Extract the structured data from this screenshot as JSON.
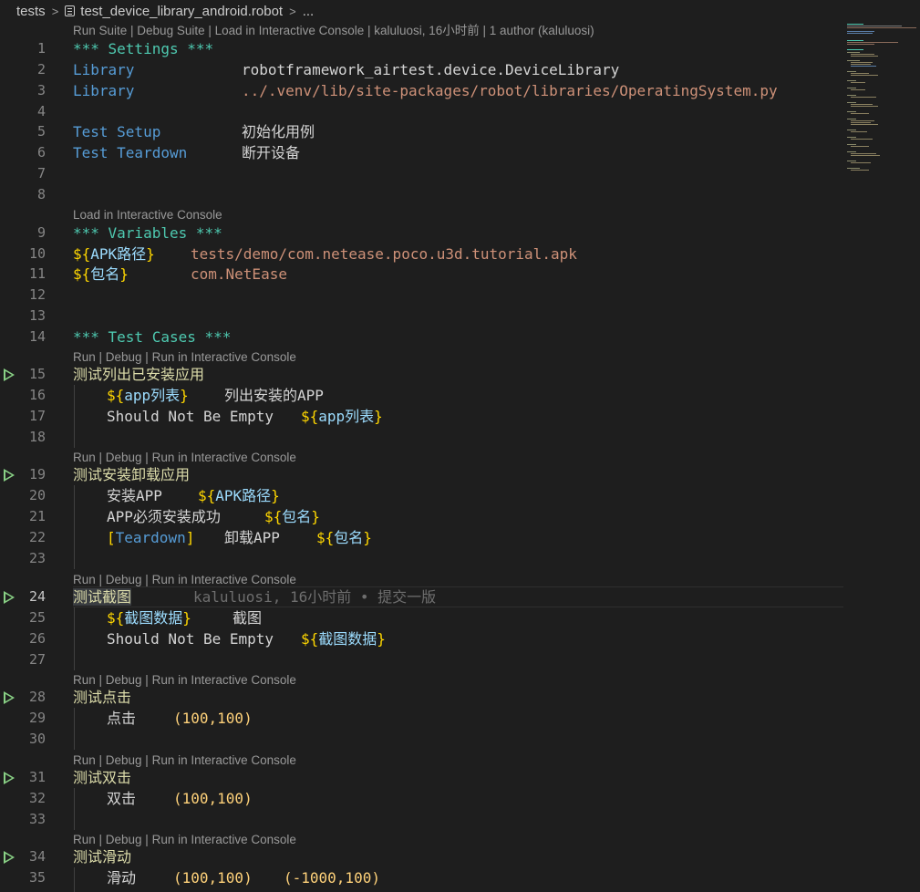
{
  "breadcrumb": {
    "folder": "tests",
    "file": "test_device_library_android.robot",
    "more": "..."
  },
  "codelens": {
    "top": "Run Suite | Debug Suite | Load in Interactive Console | kaluluosi, 16小时前 | 1 author (kaluluosi)",
    "variables": "Load in Interactive Console",
    "case": "Run | Debug | Run in Interactive Console"
  },
  "lines": {
    "l1": "*** Settings ***",
    "l2_key": "Library",
    "l2_val": "robotframework_airtest.device.DeviceLibrary",
    "l3_key": "Library",
    "l3_val": "../.venv/lib/site-packages/robot/libraries/OperatingSystem.py",
    "l5_key": "Test Setup",
    "l5_val": "初始化用例",
    "l6_key": "Test Teardown",
    "l6_val": "断开设备",
    "l9": "*** Variables ***",
    "l10_open": "${",
    "l10_name": "APK路径",
    "l10_close": "}",
    "l10_val": "tests/demo/com.netease.poco.u3d.tutorial.apk",
    "l11_open": "${",
    "l11_name": "包名",
    "l11_close": "}",
    "l11_val": "com.NetEase",
    "l14": "*** Test Cases ***",
    "l15": "测试列出已安装应用",
    "l16_open": "${",
    "l16_name": "app列表",
    "l16_close": "}",
    "l16_kw": "列出安装的APP",
    "l17_kw": "Should Not Be Empty",
    "l17_open": "${",
    "l17_name": "app列表",
    "l17_close": "}",
    "l19": "测试安装卸载应用",
    "l20_kw": "安装APP",
    "l20_open": "${",
    "l20_name": "APK路径",
    "l20_close": "}",
    "l21_kw": "APP必须安装成功",
    "l21_open": "${",
    "l21_name": "包名",
    "l21_close": "}",
    "l22_br_open": "[",
    "l22_setting": "Teardown",
    "l22_br_close": "]",
    "l22_kw": "卸载APP",
    "l22_open": "${",
    "l22_name": "包名",
    "l22_close": "}",
    "l24": "测试截图",
    "l24_blame": "kaluluosi, 16小时前 • 提交一版",
    "l25_open": "${",
    "l25_name": "截图数据",
    "l25_close": "}",
    "l25_kw": "截图",
    "l26_kw": "Should Not Be Empty",
    "l26_open": "${",
    "l26_name": "截图数据",
    "l26_close": "}",
    "l28": "测试点击",
    "l29_kw": "点击",
    "l29_arg": "(100,100)",
    "l31": "测试双击",
    "l32_kw": "双击",
    "l32_arg": "(100,100)",
    "l34": "测试滑动",
    "l35_kw": "滑动",
    "l35_arg1": "(100,100)",
    "l35_arg2": "(-1000,100)"
  },
  "line_numbers": [
    "1",
    "2",
    "3",
    "4",
    "5",
    "6",
    "7",
    "8",
    "9",
    "10",
    "11",
    "12",
    "13",
    "14",
    "15",
    "16",
    "17",
    "18",
    "19",
    "20",
    "21",
    "22",
    "23",
    "24",
    "25",
    "26",
    "27",
    "28",
    "29",
    "30",
    "31",
    "32",
    "33",
    "34",
    "35"
  ],
  "colors": {
    "background": "#1e1e1e",
    "section": "#4ec9b0",
    "setting": "#569cd6",
    "string": "#ce9178",
    "variable": "#ffd700",
    "run_icon": "#89d185"
  },
  "icons": {
    "file": "robot-file-icon",
    "run": "run-test-icon"
  }
}
